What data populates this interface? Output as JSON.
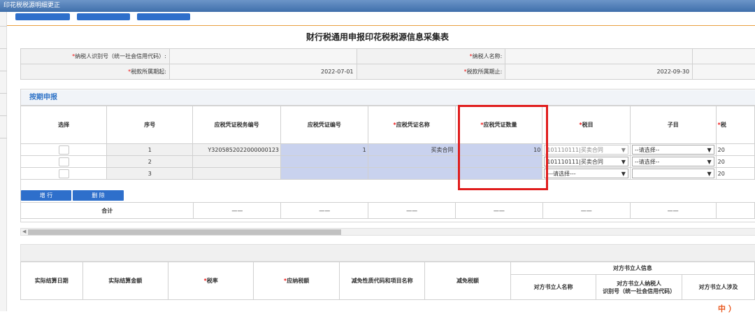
{
  "window": {
    "title": "印花税税源明细更正"
  },
  "form": {
    "title": "财行税通用申报印花税税源信息采集表"
  },
  "info": {
    "taxpayer_id_label": "纳税人识别号（统一社会信用代码）:",
    "taxpayer_name_label": "纳税人名称:",
    "period_start_label": "税款所属期起:",
    "period_start": "2022-07-01",
    "period_end_label": "税款所属期止:",
    "period_end": "2022-09-30"
  },
  "section": {
    "title": "按期申报"
  },
  "table": {
    "columns": {
      "select": "选择",
      "seq": "序号",
      "voucher_tax_no": "应税凭证税务编号",
      "voucher_no": "应税凭证编号",
      "voucher_name": "应税凭证名称",
      "voucher_qty": "应税凭证数量",
      "tax_item": "税目",
      "sub_item": "子目",
      "next": "税"
    },
    "rows": [
      {
        "seq": "1",
        "tax_no": "Y3205852022000000123",
        "voucher_no": "1",
        "voucher_name": "买卖合同",
        "qty": "10",
        "tax_item": "101110111|买卖合同",
        "sub_item": "--请选择--",
        "next": "20"
      },
      {
        "seq": "2",
        "tax_no": "",
        "voucher_no": "",
        "voucher_name": "",
        "qty": "",
        "tax_item": "101110111|买卖合同",
        "sub_item": "--请选择--",
        "next": "20"
      },
      {
        "seq": "3",
        "tax_no": "",
        "voucher_no": "",
        "voucher_name": "",
        "qty": "",
        "tax_item": "---请选择---",
        "sub_item": "",
        "next": "20"
      }
    ]
  },
  "buttons": {
    "add_row": "增 行",
    "delete": "删 除"
  },
  "summary": {
    "label": "合计",
    "dash": "——"
  },
  "bottom": {
    "actual_settle_date": "实际结算日期",
    "actual_settle_amount": "实际结算金额",
    "tax_rate": "税率",
    "tax_payable": "应纳税额",
    "relief_code": "减免性质代码和项目名称",
    "relief_amount": "减免税额",
    "counterparty_group": "对方书立人信息",
    "counterparty_name": "对方书立人名称",
    "counterparty_id_1": "对方书立人纳税人",
    "counterparty_id_2": "识别号（统一社会信用代码）",
    "counterparty_more": "对方书立人涉及"
  },
  "logo": {
    "text": "中 ）"
  }
}
